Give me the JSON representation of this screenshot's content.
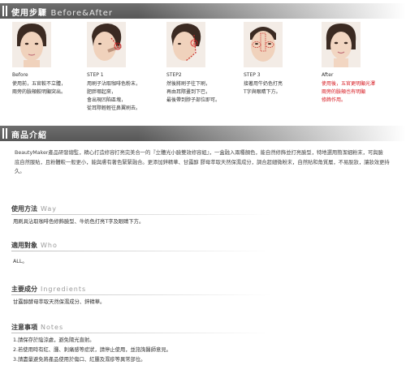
{
  "usage_header": {
    "title_cn": "使用步驟",
    "title_en": "Before&After"
  },
  "steps": [
    {
      "label": "Before",
      "desc": "使用前，五官較不立體，\n兩旁的臉頰較明顯突出。"
    },
    {
      "label": "STEP 1",
      "desc": "用刷子沾取咖啡色粉末，\n肥胖哪起來，\n會出現凹陷區塊，\n從耳際輕輕往鼻翼刷去。"
    },
    {
      "label": "STEP2",
      "desc": "然後將刷子往下刷，\n再由耳際畫到下巴，\n最後帶到脖子部位即可。"
    },
    {
      "label": "STEP 3",
      "desc": "接著用牛奶色打亮\nT字與眼睛下方。"
    },
    {
      "label": "After",
      "desc": "使用後，五官更明顯光澤\n兩旁的臉頰也有明顯\n修飾作用。"
    }
  ],
  "product_header": {
    "title_cn": "商品介紹"
  },
  "intro_text": "BeautyMaker產品研發總監，精心打造修容打亮完美合一的『立體光小臉雙效修容組』，一盒融入兩種顏色，能自然修飾並打亮臉型，特地選用簡潔細粉末，可與臉 底自然服貼，且粉體較一般更小，能與膚有著色緊緊融合。更添加鋅精華、甘露醇 膠母萃取天然保濕成分，調合超細微粉末，自然貼和角質層，不易脫妝，讓妝效更持久。",
  "sections": {
    "method": {
      "title_cn": "使用方法",
      "title_en": "Way",
      "text": "用刷具沾取咖啡色修飾臉型、牛奶色打亮T字及眼睛下方。"
    },
    "who": {
      "title_cn": "適用對象",
      "title_en": "Who",
      "text": "ALL。"
    },
    "ingredients": {
      "title_cn": "主要成分",
      "title_en": "Ingredients",
      "text": "甘露醇酵母萃取天然保濕成分、鋅精華。"
    },
    "notes": {
      "title_cn": "注意事項",
      "title_en": "Notes",
      "items": [
        "1.請保存於陰涼處，避免陽光直射。",
        "2.若使用時有紅、腫、刺痛感等症狀，請停止使用，並諮詢醫師意見。",
        "3.請盡量避免將產品使用於傷口、紅腫及濕疹等異常部位。"
      ]
    }
  },
  "colors": {
    "accent_red": "#d61920",
    "banner": "#5f5f5f"
  }
}
